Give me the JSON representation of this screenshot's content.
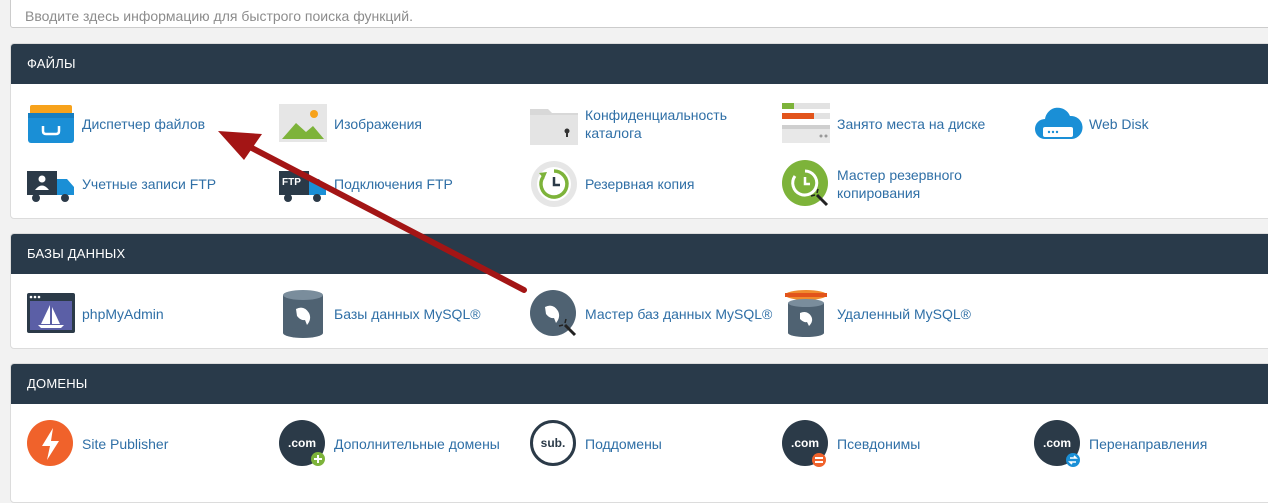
{
  "search": {
    "placeholder": "Вводите здесь информацию для быстрого поиска функций."
  },
  "sections": {
    "files": {
      "title": "ФАЙЛЫ",
      "items": {
        "file_manager": "Диспетчер файлов",
        "images": "Изображения",
        "directory_privacy": "Конфиденциальность каталога",
        "disk_usage": "Занято места на диске",
        "web_disk": "Web Disk",
        "ftp_accounts": "Учетные записи FTP",
        "ftp_connections": "Подключения FTP",
        "backup": "Резервная копия",
        "backup_wizard": "Мастер резервного копирования"
      }
    },
    "databases": {
      "title": "БАЗЫ ДАННЫХ",
      "items": {
        "phpmyadmin": "phpMyAdmin",
        "mysql_databases": "Базы данных MySQL®",
        "mysql_wizard": "Мастер баз данных MySQL®",
        "remote_mysql": "Удаленный MySQL®"
      }
    },
    "domains": {
      "title": "ДОМЕНЫ",
      "items": {
        "site_publisher": "Site Publisher",
        "addon_domains": "Дополнительные домены",
        "subdomains": "Поддомены",
        "aliases": "Псевдонимы",
        "redirects": "Перенаправления"
      }
    }
  },
  "icon_text": {
    "com": ".com",
    "sub": "sub.",
    "ftp": "FTP"
  },
  "colors": {
    "header_bg": "#293a4a",
    "link": "#2f6fa6",
    "arrow": "#a31515"
  }
}
